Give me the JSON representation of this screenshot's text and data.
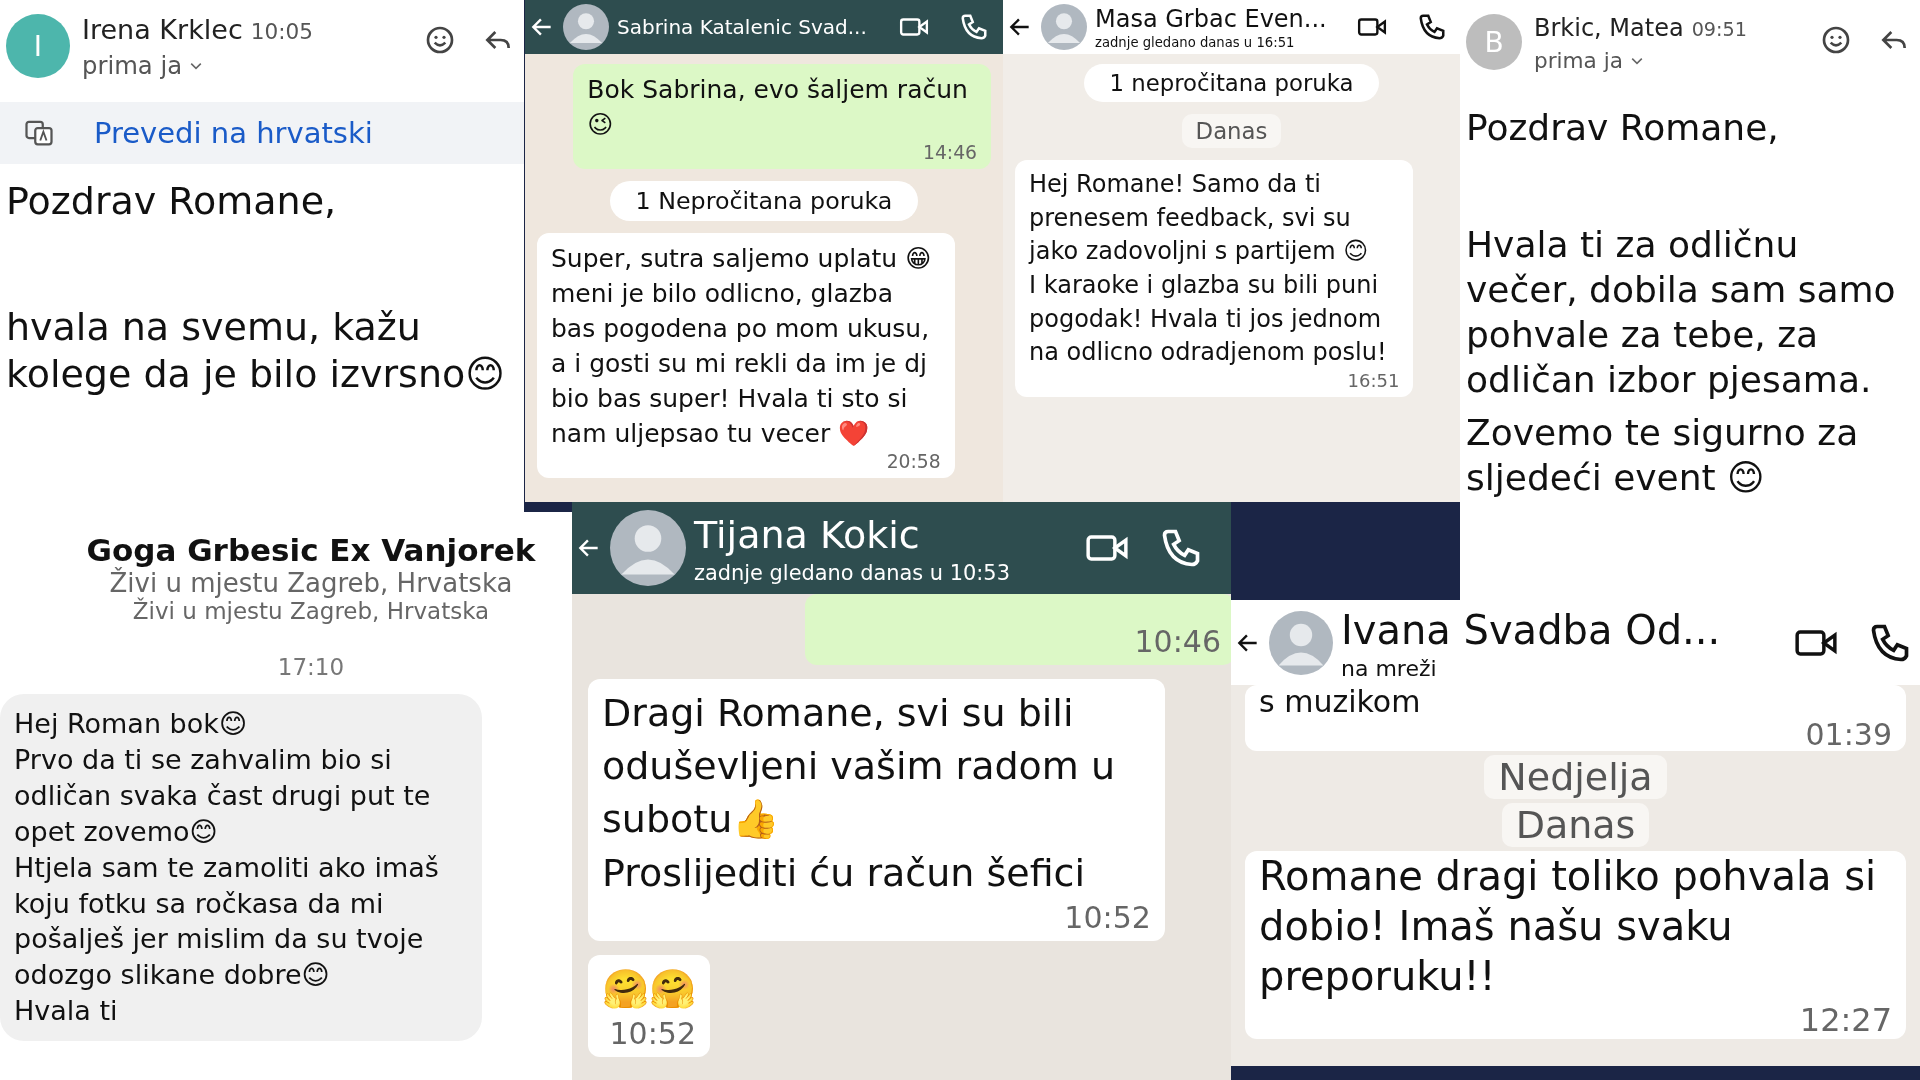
{
  "panels": [
    {
      "kind": "email",
      "avatar_letter": "I",
      "color": "#4db6ac",
      "sender": "Irena Krklec",
      "time": "10:05",
      "recipient": "prima ja",
      "translate": "Prevedi na hrvatski",
      "body": [
        "Pozdrav Romane,",
        "hvala na svemu, kažu kolege da je bilo izvrsno😊"
      ]
    },
    {
      "kind": "chat",
      "header": {
        "kind": "dark",
        "name": "Sabrina Katalenic Svad..."
      },
      "messages": [
        {
          "kind": "outgoing",
          "text": "Bok Sabrina, evo šaljem račun 😉",
          "time": "14:46"
        },
        {
          "kind": "banner",
          "text": "1 Nepročitana poruka"
        },
        {
          "kind": "incoming",
          "text": "Super, sutra saljemo uplatu 😁 meni je bilo odlicno, glazba bas pogodena po mom ukusu, a i gosti su mi rekli da im je dj bio bas super! Hvala ti sto si nam uljepsao tu vecer ❤️",
          "time": "20:58"
        }
      ]
    },
    {
      "kind": "chat",
      "header": {
        "kind": "light",
        "name": "Masa Grbac Even...",
        "status": "zadnje gledano danas u 16:51"
      },
      "messages": [
        {
          "kind": "banner",
          "text": "1 nepročitana poruka"
        },
        {
          "kind": "date",
          "text": "Danas"
        },
        {
          "kind": "incoming",
          "text": "Hej Romane! Samo da ti prenesem feedback, svi su jako zadovoljni s partijem 😊\nI karaoke i glazba su bili puni pogodak! Hvala ti jos jednom na odlicno odradjenom poslu!",
          "time": "16:51"
        }
      ]
    },
    {
      "kind": "email",
      "avatar_letter": "B",
      "color": "#bdbdbd",
      "sender": "Brkic, Matea",
      "time": "09:51",
      "recipient": "prima ja",
      "body": [
        "Pozdrav Romane,",
        "Hvala ti za odličnu večer, dobila sam samo pohvale za tebe, za odličan izbor pjesama.",
        "Zovemo te sigurno za sljedeći event 😊"
      ]
    },
    {
      "kind": "profile",
      "name": "Goga Grbesic Ex Vanjorek",
      "subtitles": [
        "Živi u mjestu Zagreb, Hrvatska",
        "Živi u mjestu Zagreb, Hrvatska"
      ],
      "time": "17:10",
      "message": "Hej Roman bok😊\nPrvo da ti se zahvalim bio si odličan svaka čast drugi put te opet zovemo😊\nHtjela sam te zamoliti ako imaš koju fotku sa ročkasa da mi pošalješ jer mislim da su tvoje odozgo slikane dobre😊\nHvala ti"
    },
    {
      "kind": "chat",
      "header": {
        "kind": "dark",
        "name": "Tijana Kokic",
        "status": "zadnje gledano danas u 10:53"
      },
      "messages": [
        {
          "kind": "outgoing",
          "time": "10:46"
        },
        {
          "kind": "incoming",
          "text": "Dragi Romane, svi su bili oduševljeni vašim radom u subotu👍\nProslijediti ću račun šefici",
          "time": "10:52"
        },
        {
          "kind": "incoming",
          "text": "🤗🤗",
          "time": "10:52"
        }
      ]
    },
    {
      "kind": "chat",
      "header": {
        "kind": "light",
        "name": "Ivana Svadba Od...",
        "status": "na mreži"
      },
      "messages": [
        {
          "kind": "incoming",
          "text": "s muzikom",
          "time": "01:39"
        },
        {
          "kind": "date",
          "text": "Nedjelja"
        },
        {
          "kind": "date",
          "text": "Danas"
        },
        {
          "kind": "incoming",
          "text": "Romane dragi toliko pohvala si dobio! Imaš našu svaku preporuku!!",
          "time": "12:27"
        }
      ]
    }
  ]
}
